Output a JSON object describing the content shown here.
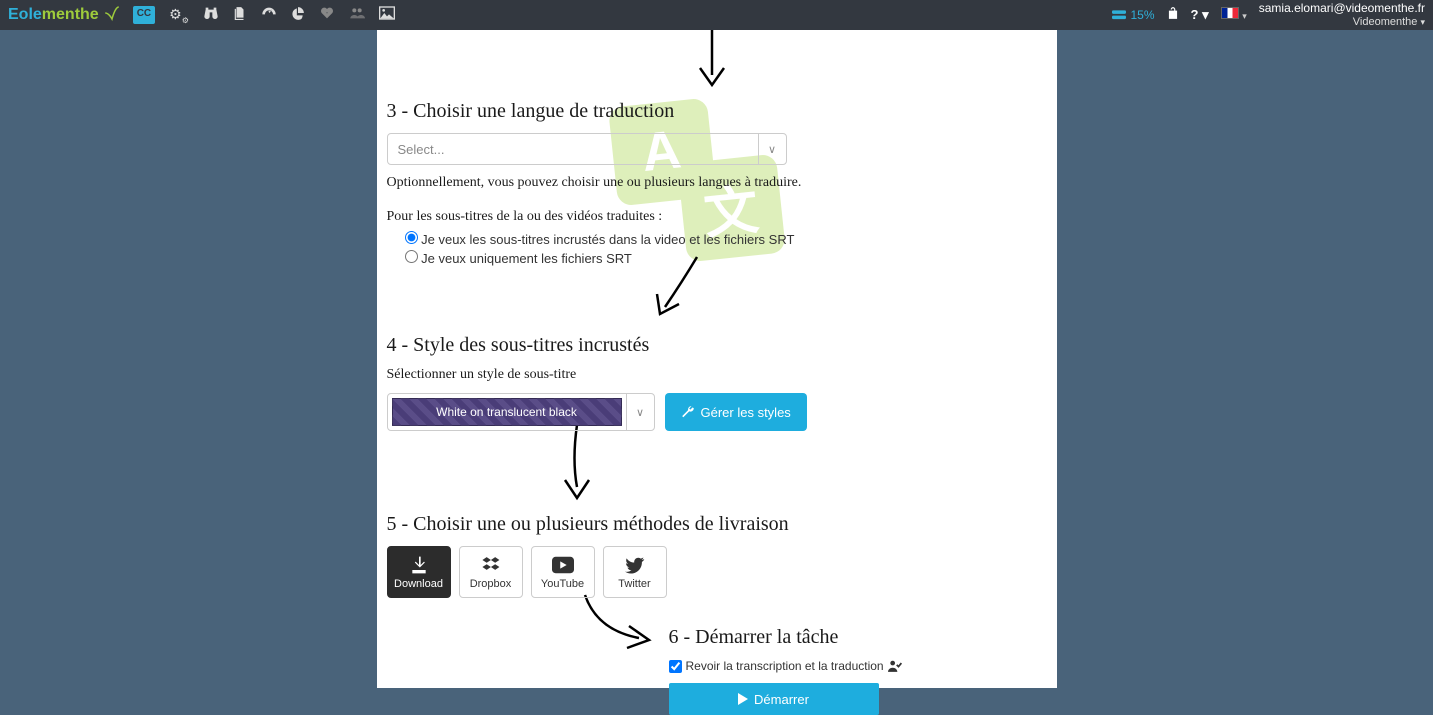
{
  "header": {
    "logo": {
      "part1": "Eole",
      "part2": "menthe"
    },
    "storage_percent": "15%",
    "user_email": "samia.elomari@videomenthe.fr",
    "user_org": "Videomenthe"
  },
  "step3": {
    "title": "3 - Choisir une langue de traduction",
    "select_placeholder": "Select...",
    "helper": "Optionnellement, vous pouvez choisir une ou plusieurs langues à traduire.",
    "note": "Pour les sous-titres de la ou des vidéos traduites :",
    "radio1": "Je veux les sous-titres incrustés dans la video et les fichiers SRT",
    "radio2": "Je veux uniquement les fichiers SRT"
  },
  "step4": {
    "title": "4 - Style des sous-titres incrustés",
    "subtitle": "Sélectionner un style de sous-titre",
    "style_name": "White on translucent black",
    "manage_btn": "Gérer les styles"
  },
  "step5": {
    "title": "5 - Choisir une ou plusieurs méthodes de livraison",
    "options": {
      "download": "Download",
      "dropbox": "Dropbox",
      "youtube": "YouTube",
      "twitter": "Twitter"
    }
  },
  "step6": {
    "title": "6 - Démarrer la tâche",
    "review_label": "Revoir la transcription et la traduction",
    "start_btn": "Démarrer"
  }
}
